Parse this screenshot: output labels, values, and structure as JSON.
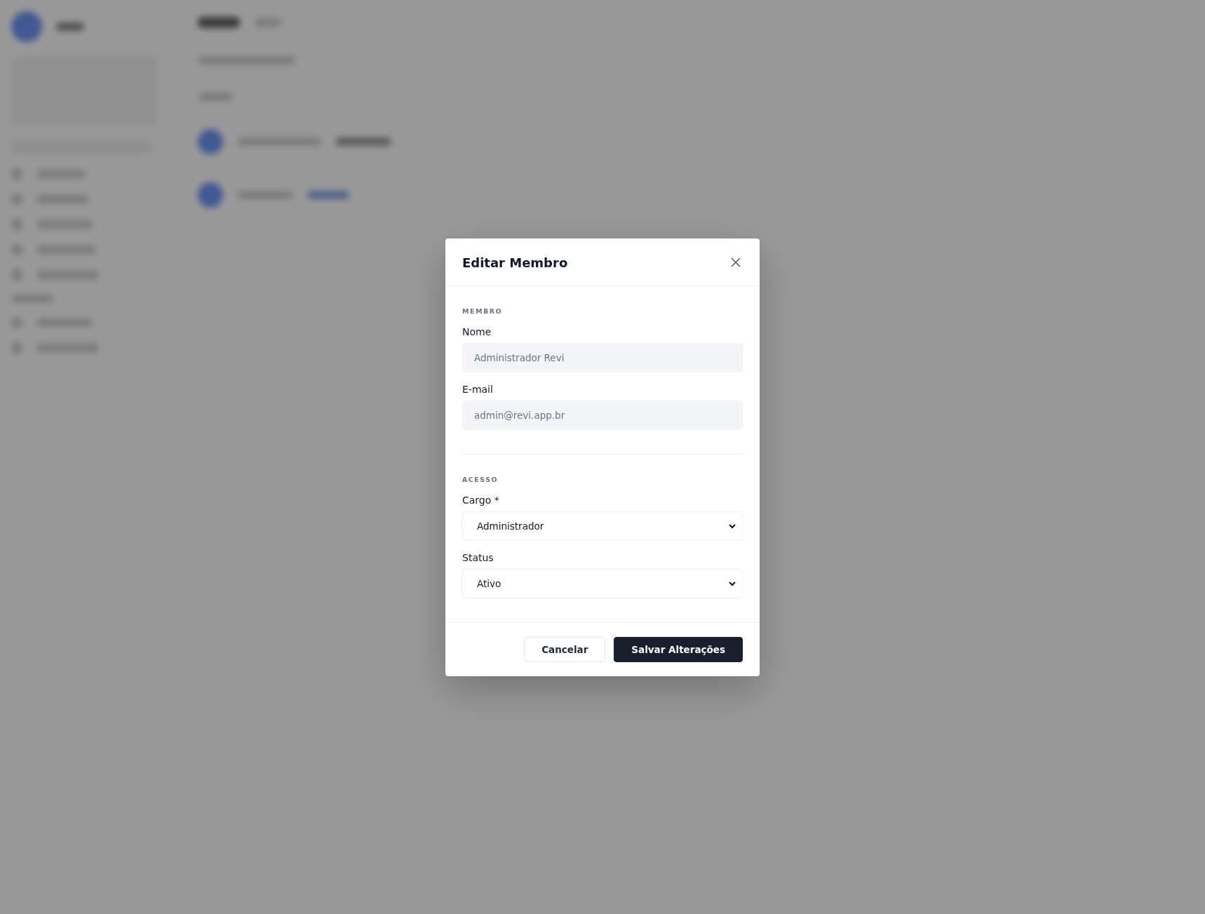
{
  "modal": {
    "title": "Editar Membro",
    "sections": [
      {
        "heading": "MEMBRO",
        "fields": [
          {
            "kind": "text",
            "label": "Nome",
            "value": "Administrador Revi",
            "disabled": true
          },
          {
            "kind": "text",
            "label": "E-mail",
            "value": "admin@revi.app.br",
            "disabled": true
          }
        ]
      },
      {
        "heading": "ACESSO",
        "fields": [
          {
            "kind": "select",
            "label": "Cargo *",
            "value": "Administrador",
            "disabled": false
          },
          {
            "kind": "select",
            "label": "Status",
            "value": "Ativo",
            "disabled": false
          }
        ]
      }
    ],
    "buttons": [
      {
        "kind": "secondary",
        "label": "Cancelar"
      },
      {
        "kind": "primary",
        "label": "Salvar Alterações"
      }
    ]
  }
}
